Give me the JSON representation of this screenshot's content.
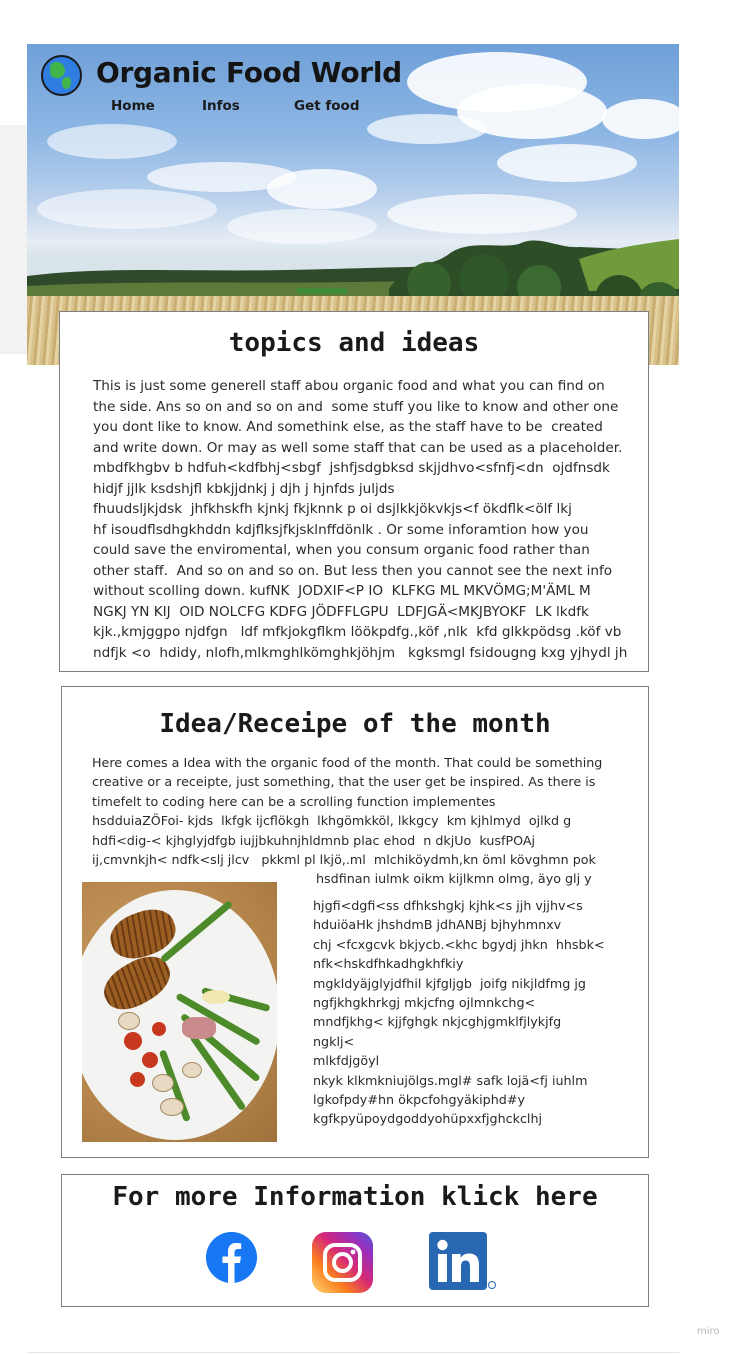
{
  "header": {
    "title": "Organic Food World",
    "logo_icon": "globe-icon",
    "nav": [
      "Home",
      "Infos",
      "Get food"
    ]
  },
  "topics": {
    "title": "topics and ideas",
    "lines": [
      "This is just some generell staff abou organic food and what you can find on",
      "the side. Ans so on and so on and  some stuff you like to know and other one",
      "you dont like to know. And somethink else, as the staff have to be  created",
      "and write down. Or may as well some staff that can be used as a placeholder.",
      "mbdfkhgbv b hdfuh<kdfbhj<sbgf  jshfjsdgbksd skjjdhvo<sfnfj<dn  ojdfnsdk",
      "hidjf jjlk ksdshjfl kbkjjdnkj j djh j hjnfds juljds",
      "fhuudsljkjdsk  jhfkhskfh kjnkj fkjknnk p oi dsjlkkjökvkjs<f ökdflk<ölf lkj",
      "hf isoudflsdhgkhddn kdjflksjfkjsklnffdönlk . Or some inforamtion how you",
      "could save the enviromental, when you consum organic food rather than",
      "other staff.  And so on and so on. But less then you cannot see the next info",
      "without scolling down. kufNK  JODXIF<P IO  KLFKG ML MKVÖMG;M'ÄML M",
      "NGKJ YN KIJ  OID NOLCFG KDFG JÖDFFLGPU  LDFJGÄ<MKJBYOKF  LK lkdfk",
      "kjk.,kmjggpo njdfgn   ldf mfkjokgflkm löökpdfg.,köf ,nlk  kfd glkkpödsg .köf vb",
      "ndfjk <o  hdidy, nlofh,mlkmghlkömghkjöhjm   kgksmgl fsidougng kxg yjhydl jh"
    ]
  },
  "idea": {
    "title": "Idea/Receipe of the month",
    "lines": [
      "Here comes a Idea with the organic food of the month. That could be something",
      "creative or a receipte, just something, that the user get be inspired. As there is",
      "timefelt to coding here can be a scrolling function implementes",
      "hsdduiaZÖFoi- kjds  lkfgk ijcflökgh  lkhgömkköl, lkkgcy  km kjhlmyd  ojlkd g",
      "hdfi<dig-< kjhglyjdfgb iujjbkuhnjhldmnb plac ehod  n dkjUo  kusfPOAj",
      "ij,cmvnkjh< ndfk<slj jlcv   pkkml pl lkjö,.ml  mlchiköydmh,kn öml kövghmn pok"
    ],
    "caption_line": "hsdfinan iulmk oikm kijlkmn olmg, äyo glj y",
    "side_lines": [
      "hjgfi<dgfi<ss dfhkshgkj kjhk<s jjh vjjhv<s",
      "hduiöaHk jhshdmB jdhANBj bjhyhmnxv",
      "chj <fcxgcvk bkjycb.<khc bgydj jhkn  hhsbk<",
      "nfk<hskdfhkadhgkhfkiy",
      "mgkldyäjglyjdfhil kjfgljgb  joifg nikjldfmg jg",
      "ngfjkhgkhrkgj mkjcfng ojlmnkchg<",
      "mndfjkhg< kjjfghgk nkjcghjgmklfjlykjfg",
      "ngklj<",
      "mlkfdjgöyl",
      "nkyk klkmkniujölgs.mgl# safk lojä<fj iuhlm",
      "lgkofpdy#hn ökpcfohgyäkiphd#y",
      "kgfkpyüpoydgoddyohüpxxfjghckclhj"
    ]
  },
  "more_info": {
    "title": "For more Information klick here",
    "icons": [
      "facebook-icon",
      "instagram-icon",
      "linkedin-icon"
    ]
  },
  "watermark": "miro"
}
